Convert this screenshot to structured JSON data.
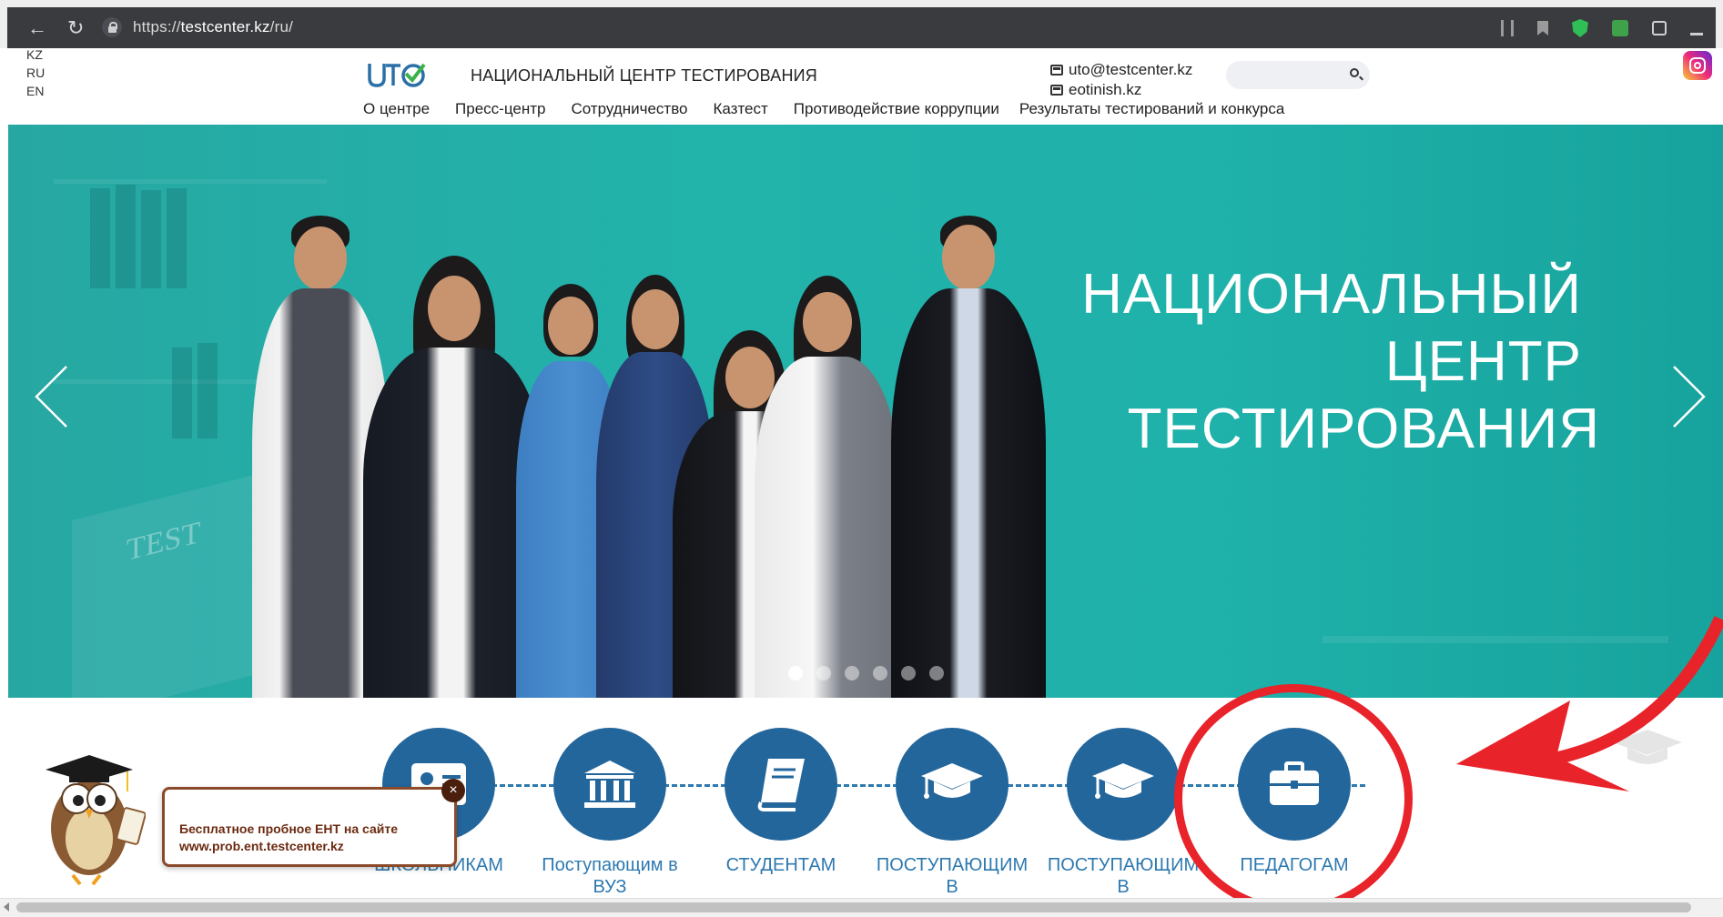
{
  "browser": {
    "url_prefix": "https://",
    "url_host": "testcenter.kz",
    "url_path": "/ru/"
  },
  "languages": [
    "KZ",
    "RU",
    "EN"
  ],
  "header": {
    "logo_text": "UTC",
    "site_title": "НАЦИОНАЛЬНЫЙ ЦЕНТР ТЕСТИРОВАНИЯ",
    "email": "uto@testcenter.kz",
    "eotinish": "eotinish.kz",
    "search_placeholder": ""
  },
  "nav": [
    "О центре",
    "Пресс-центр",
    "Сотрудничество",
    "Казтест",
    "Противодействие коррупции",
    "Результаты тестирований и конкурса"
  ],
  "hero": {
    "line1": "НАЦИОНАЛЬНЫЙ",
    "line2": "ЦЕНТР",
    "line3": "ТЕСТИРОВАНИЯ",
    "slide_count": 6,
    "active_slide": 0,
    "board_text": "TEST"
  },
  "categories": [
    {
      "label": "ШКОЛЬНИКАМ",
      "icon": "id-card-icon"
    },
    {
      "label": "Поступающим в ВУЗ",
      "icon": "university-icon"
    },
    {
      "label": "СТУДЕНТАМ",
      "icon": "book-icon"
    },
    {
      "label": "ПОСТУПАЮЩИМ В",
      "icon": "graduation-cap-icon"
    },
    {
      "label": "ПОСТУПАЮЩИМ В",
      "icon": "graduation-cap-icon"
    },
    {
      "label": "ПЕДАГОГАМ",
      "icon": "briefcase-icon"
    }
  ],
  "popup": {
    "line1": "Бесплатное пробное ЕНТ на сайте",
    "line2": "www.prob.ent.testcenter.kz",
    "close": "×"
  },
  "colors": {
    "accent": "#23669c",
    "hero_bg": "#22b3ab",
    "annotation": "#e8232a"
  }
}
